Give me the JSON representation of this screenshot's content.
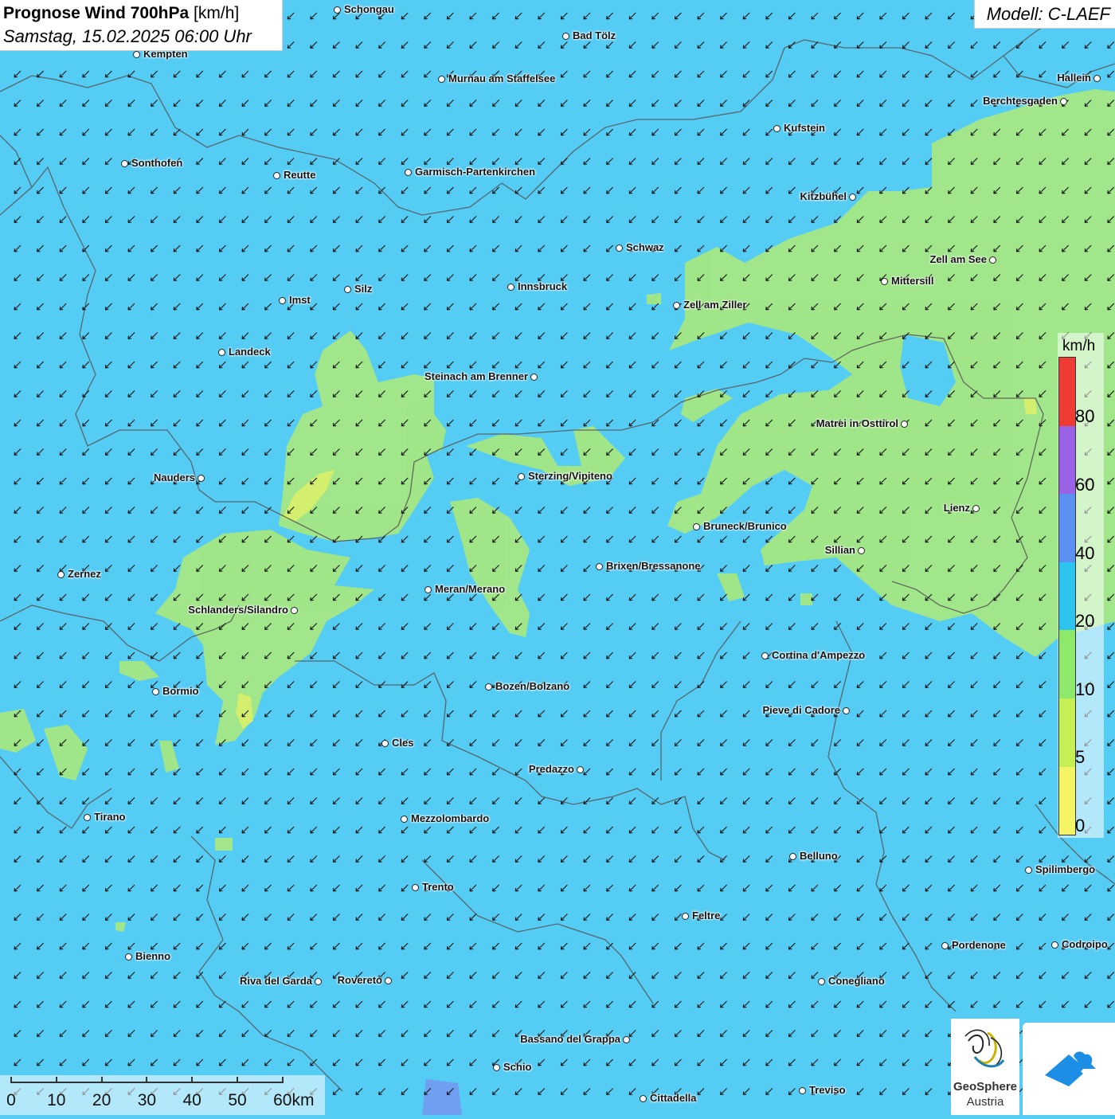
{
  "header": {
    "title_bold": "Prognose Wind 700hPa",
    "title_unit": "[km/h]",
    "datetime": "Samstag, 15.02.2025 06:00 Uhr",
    "model": "Modell: C-LAEF"
  },
  "legend": {
    "unit": "km/h",
    "ticks": [
      "0",
      "5",
      "10",
      "20",
      "40",
      "60",
      "80"
    ],
    "colors": [
      "#f4f466",
      "#c5f055",
      "#8ee86a",
      "#2cc3ee",
      "#5b8ff2",
      "#9a63e6",
      "#ee3b33"
    ]
  },
  "scale_bar": {
    "labels": [
      "0",
      "10",
      "20",
      "30",
      "40",
      "50",
      "60km"
    ]
  },
  "colors": {
    "sea": "#55ccf4",
    "wind_low": "#a8e880",
    "wind_very_low": "#d9ee6a",
    "border": "#555555",
    "arrow": "#111111"
  },
  "wind": {
    "direction": "northeast",
    "arrow_icon": "wind-arrow-southwest-icon"
  },
  "cities": [
    {
      "name": "Schongau"
    },
    {
      "name": "Bad Tölz"
    },
    {
      "name": "Kempten"
    },
    {
      "name": "Murnau am Staffelsee"
    },
    {
      "name": "Hallein"
    },
    {
      "name": "Berchtesgaden"
    },
    {
      "name": "Kufstein"
    },
    {
      "name": "Sonthofen"
    },
    {
      "name": "Reutte"
    },
    {
      "name": "Garmisch-Partenkirchen"
    },
    {
      "name": "Kitzbühel"
    },
    {
      "name": "Schwaz"
    },
    {
      "name": "Zell am See"
    },
    {
      "name": "Mittersill"
    },
    {
      "name": "Innsbruck"
    },
    {
      "name": "Silz"
    },
    {
      "name": "Imst"
    },
    {
      "name": "Zell am Ziller"
    },
    {
      "name": "Landeck"
    },
    {
      "name": "Steinach am Brenner"
    },
    {
      "name": "Matrei in Osttirol"
    },
    {
      "name": "Nauders"
    },
    {
      "name": "Sterzing/Vipiteno"
    },
    {
      "name": "Lienz"
    },
    {
      "name": "Bruneck/Brunico"
    },
    {
      "name": "Sillian"
    },
    {
      "name": "Zernez"
    },
    {
      "name": "Brixen/Bressanone"
    },
    {
      "name": "Meran/Merano"
    },
    {
      "name": "Schlanders/Silandro"
    },
    {
      "name": "Cortina d'Ampezzo"
    },
    {
      "name": "Bozen/Bolzano"
    },
    {
      "name": "Bormio"
    },
    {
      "name": "Pieve di Cadore"
    },
    {
      "name": "Cles"
    },
    {
      "name": "Predazzo"
    },
    {
      "name": "Tirano"
    },
    {
      "name": "Mezzolombardo"
    },
    {
      "name": "Belluno"
    },
    {
      "name": "Spilimbergo"
    },
    {
      "name": "Trento"
    },
    {
      "name": "Feltre"
    },
    {
      "name": "Pordenone"
    },
    {
      "name": "Codroipo"
    },
    {
      "name": "Bienno"
    },
    {
      "name": "Riva del Garda"
    },
    {
      "name": "Rovereto"
    },
    {
      "name": "Conegliano"
    },
    {
      "name": "Bassano del Grappa"
    },
    {
      "name": "Schio"
    },
    {
      "name": "Treviso"
    },
    {
      "name": "Cittadella"
    }
  ],
  "logos": {
    "geosphere_line1": "GeoSphere",
    "geosphere_line2": "Austria"
  }
}
